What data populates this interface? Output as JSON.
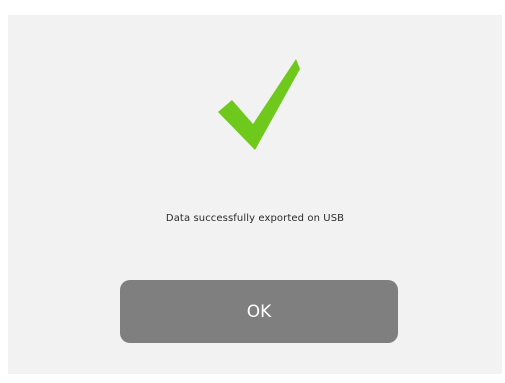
{
  "dialog": {
    "icon": "checkmark-icon",
    "message": "Data successfully exported on USB",
    "ok_label": "OK"
  },
  "colors": {
    "checkmark": "#6fc81c",
    "button": "#7f7f7f",
    "background": "#f2f2f2"
  }
}
